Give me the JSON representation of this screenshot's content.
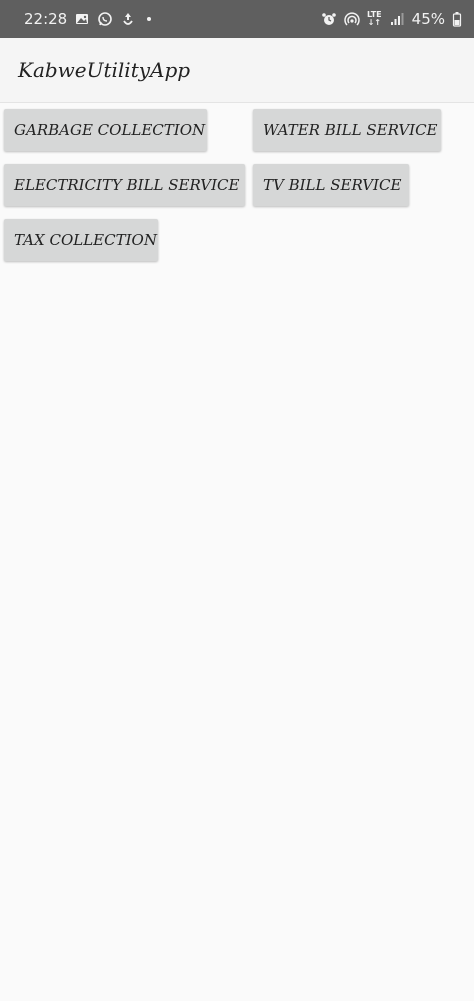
{
  "status_bar": {
    "time": "22:28",
    "battery": "45%",
    "network": "LTE",
    "icons": [
      "gallery-icon",
      "whatsapp-icon",
      "upload-icon",
      "dot-icon",
      "alarm-icon",
      "hotspot-icon",
      "lte-icon",
      "signal-icon",
      "battery-icon"
    ]
  },
  "app_bar": {
    "title": "KabweUtilityApp"
  },
  "buttons": {
    "garbage": "GARBAGE COLLECTION",
    "water": "WATER BILL SERVICE",
    "electricity": "ELECTRICITY BILL SERVICE",
    "tv": "TV BILL SERVICE",
    "tax": "TAX COLLECTION"
  },
  "colors": {
    "status_bar_bg": "#5f5f5f",
    "app_bar_bg": "#f5f5f5",
    "button_bg": "#d6d7d7",
    "page_bg": "#fafafa"
  }
}
